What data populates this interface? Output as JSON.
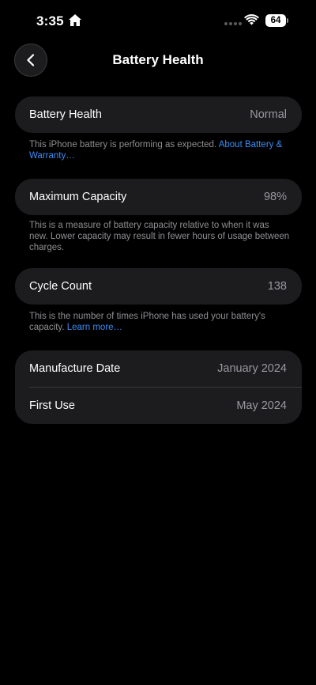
{
  "status_bar": {
    "time": "3:35",
    "battery_level": "64",
    "icons": [
      "home-icon",
      "signal-dots",
      "wifi-icon",
      "battery-icon"
    ]
  },
  "nav": {
    "back_icon": "chevron-left-icon",
    "title": "Battery Health"
  },
  "health": {
    "label": "Battery Health",
    "value": "Normal",
    "footnote_text": "This iPhone battery is performing as expected. ",
    "footnote_link": "About Battery & Warranty…"
  },
  "capacity": {
    "label": "Maximum Capacity",
    "value": "98%",
    "footnote_text": "This is a measure of battery capacity relative to when it was new. Lower capacity may result in fewer hours of usage between charges."
  },
  "cycles": {
    "label": "Cycle Count",
    "value": "138",
    "footnote_text": "This is the number of times iPhone has used your battery's capacity. ",
    "footnote_link": "Learn more…"
  },
  "dates": {
    "manufacture_label": "Manufacture Date",
    "manufacture_value": "January 2024",
    "first_use_label": "First Use",
    "first_use_value": "May 2024"
  },
  "colors": {
    "background": "#000000",
    "card": "#1c1c1e",
    "secondary_text": "#98989f",
    "link": "#3c8cf5"
  }
}
